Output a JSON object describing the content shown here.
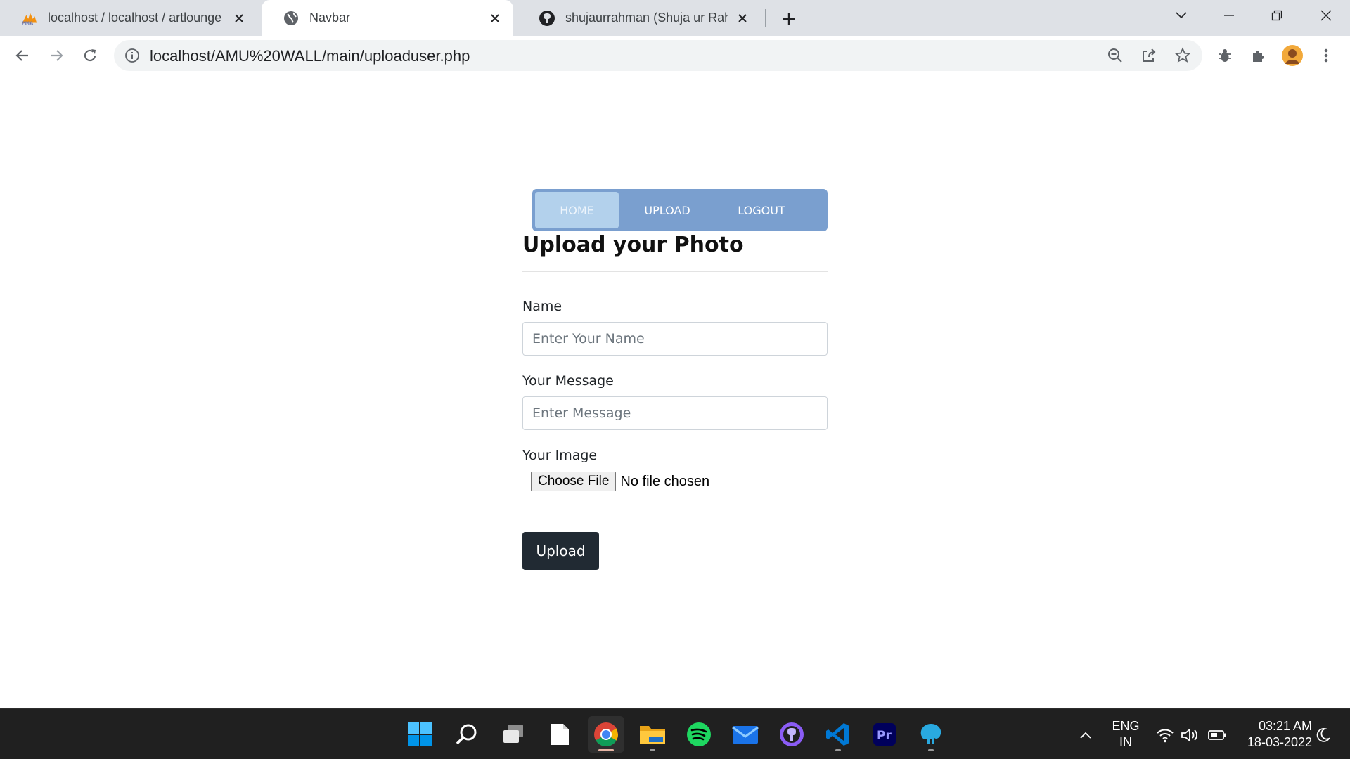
{
  "browser": {
    "tabs": [
      {
        "title": "localhost / localhost / artlounge / ...",
        "favicon": "phpmyadmin-icon",
        "active": false
      },
      {
        "title": "Navbar",
        "favicon": "globe-icon",
        "active": true
      },
      {
        "title": "shujaurrahman (Shuja ur Rahman)",
        "favicon": "github-icon",
        "active": false
      }
    ],
    "url": "localhost/AMU%20WALL/main/uploaduser.php"
  },
  "nav": {
    "items": [
      {
        "label": "HOME",
        "active": true
      },
      {
        "label": "UPLOAD",
        "active": false
      },
      {
        "label": "LOGOUT",
        "active": false
      }
    ]
  },
  "form": {
    "heading": "Upload your Photo",
    "name_label": "Name",
    "name_placeholder": "Enter Your Name",
    "message_label": "Your Message",
    "message_placeholder": "Enter Message",
    "image_label": "Your Image",
    "file_button": "Choose File",
    "file_status": "No file chosen",
    "submit_label": "Upload"
  },
  "taskbar": {
    "apps": [
      "windows-start",
      "search",
      "task-view",
      "notepad",
      "chrome",
      "file-explorer",
      "spotify",
      "mail",
      "github-desktop",
      "vscode",
      "premiere-pro",
      "node-app"
    ],
    "language_primary": "ENG",
    "language_secondary": "IN",
    "time": "03:21 AM",
    "date": "18-03-2022"
  },
  "colors": {
    "navbar": "#7a9fcf",
    "nav_active": "#b3d1ec",
    "submit": "#212a33"
  }
}
